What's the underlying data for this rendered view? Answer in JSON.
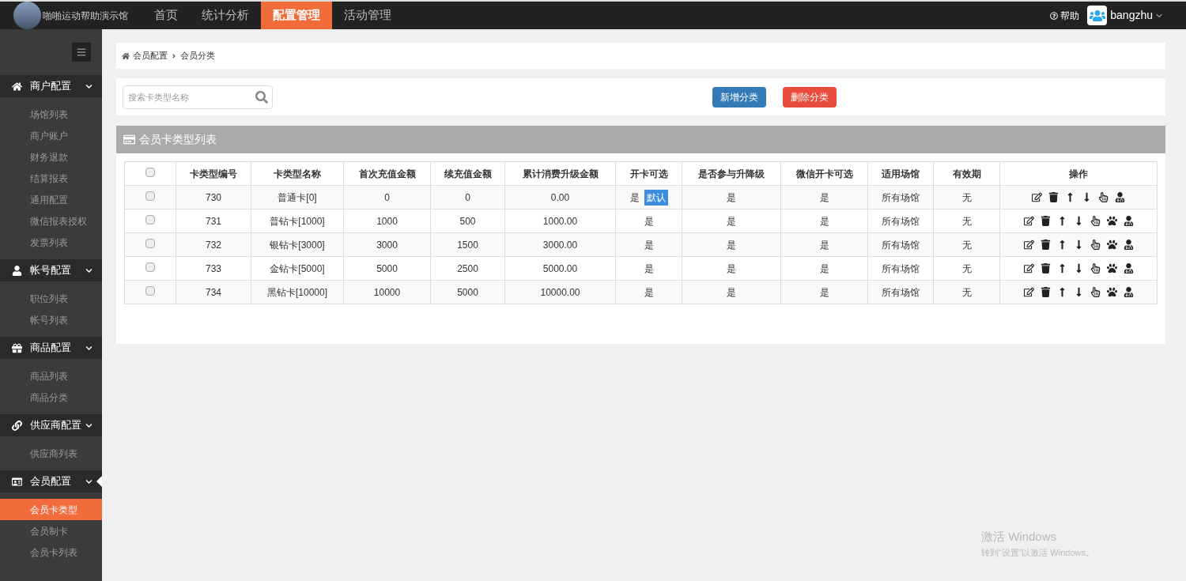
{
  "topbar": {
    "site_name": "啪啪运动帮助演示馆",
    "nav": [
      {
        "label": "首页",
        "selected": false
      },
      {
        "label": "统计分析",
        "selected": false
      },
      {
        "label": "配置管理",
        "selected": true
      },
      {
        "label": "活动管理",
        "selected": false
      }
    ],
    "help": "帮助",
    "user": "bangzhu"
  },
  "sidebar": {
    "sections": [
      {
        "kind": "home",
        "label": "商户配置",
        "expanded": true,
        "items": [
          {
            "label": "场馆列表",
            "selected": false
          },
          {
            "label": "商户账户",
            "selected": false
          },
          {
            "label": "财务退款",
            "selected": false
          },
          {
            "label": "结算报表",
            "selected": false
          },
          {
            "label": "通用配置",
            "selected": false
          },
          {
            "label": "微信报表授权",
            "selected": false
          },
          {
            "label": "发票列表",
            "selected": false
          }
        ]
      },
      {
        "kind": "user",
        "label": "帐号配置",
        "expanded": true,
        "items": [
          {
            "label": "职位列表",
            "selected": false
          },
          {
            "label": "帐号列表",
            "selected": false
          }
        ]
      },
      {
        "kind": "gift",
        "label": "商品配置",
        "expanded": true,
        "items": [
          {
            "label": "商品列表",
            "selected": false
          },
          {
            "label": "商品分类",
            "selected": false
          }
        ]
      },
      {
        "kind": "link",
        "label": "供应商配置",
        "expanded": true,
        "items": [
          {
            "label": "供应商列表",
            "selected": false
          }
        ]
      },
      {
        "kind": "card",
        "label": "会员配置",
        "expanded": true,
        "items": [
          {
            "label": "会员卡类型",
            "selected": true
          },
          {
            "label": "会员制卡",
            "selected": false
          },
          {
            "label": "会员卡列表",
            "selected": false
          }
        ]
      }
    ]
  },
  "breadcrumb": [
    "会员配置",
    "会员分类"
  ],
  "search": {
    "placeholder": "搜索卡类型名称"
  },
  "buttons": [
    {
      "label": "新增分类",
      "kind": "primary"
    },
    {
      "label": "删除分类",
      "kind": "danger"
    }
  ],
  "panel": {
    "title": "会员卡类型列表",
    "table": {
      "header_checked": false,
      "columns": [
        "卡类型编号",
        "卡类型名称",
        "首次充值金额",
        "续充值金额",
        "累计消费升级金额",
        "开卡可选",
        "是否参与升降级",
        "微信开卡可选",
        "适用场馆",
        "有效期",
        "操作"
      ],
      "rows": [
        {
          "checked": false,
          "cells": [
            "730",
            "普通卡[0]",
            "0",
            "0",
            "0.00",
            "是",
            "是",
            "是",
            "所有场馆",
            "无"
          ],
          "badge": "默认",
          "actions": [
            {
              "kind": "edit"
            },
            {
              "kind": "delete"
            },
            {
              "kind": "up"
            },
            {
              "kind": "down"
            },
            {
              "kind": "hand"
            },
            {
              "kind": "user"
            }
          ]
        },
        {
          "checked": false,
          "cells": [
            "731",
            "普钻卡[1000]",
            "1000",
            "500",
            "1000.00",
            "是",
            "是",
            "是",
            "所有场馆",
            "无"
          ],
          "actions": [
            {
              "kind": "edit"
            },
            {
              "kind": "delete"
            },
            {
              "kind": "up"
            },
            {
              "kind": "down"
            },
            {
              "kind": "hand"
            },
            {
              "kind": "paw"
            },
            {
              "kind": "user"
            }
          ]
        },
        {
          "checked": false,
          "cells": [
            "732",
            "银钻卡[3000]",
            "3000",
            "1500",
            "3000.00",
            "是",
            "是",
            "是",
            "所有场馆",
            "无"
          ],
          "actions": [
            {
              "kind": "edit"
            },
            {
              "kind": "delete"
            },
            {
              "kind": "up"
            },
            {
              "kind": "down"
            },
            {
              "kind": "hand"
            },
            {
              "kind": "paw"
            },
            {
              "kind": "user"
            }
          ]
        },
        {
          "checked": false,
          "cells": [
            "733",
            "金钻卡[5000]",
            "5000",
            "2500",
            "5000.00",
            "是",
            "是",
            "是",
            "所有场馆",
            "无"
          ],
          "actions": [
            {
              "kind": "edit"
            },
            {
              "kind": "delete"
            },
            {
              "kind": "up"
            },
            {
              "kind": "down"
            },
            {
              "kind": "hand"
            },
            {
              "kind": "paw"
            },
            {
              "kind": "user"
            }
          ]
        },
        {
          "checked": false,
          "cells": [
            "734",
            "黑钻卡[10000]",
            "10000",
            "5000",
            "10000.00",
            "是",
            "是",
            "是",
            "所有场馆",
            "无"
          ],
          "actions": [
            {
              "kind": "edit"
            },
            {
              "kind": "delete"
            },
            {
              "kind": "up"
            },
            {
              "kind": "down"
            },
            {
              "kind": "hand"
            },
            {
              "kind": "paw"
            },
            {
              "kind": "user"
            }
          ]
        }
      ]
    }
  },
  "os_notice": {
    "title": "激活 Windows",
    "text": "转到“设置”以激活 Windows。"
  }
}
